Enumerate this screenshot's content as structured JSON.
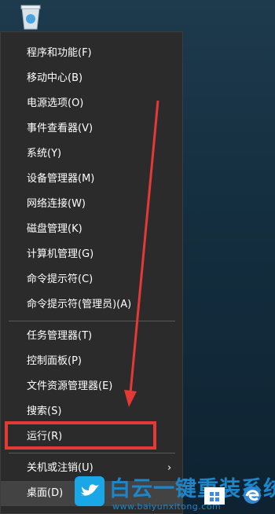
{
  "menu": {
    "items": [
      {
        "label": "程序和功能(F)"
      },
      {
        "label": "移动中心(B)"
      },
      {
        "label": "电源选项(O)"
      },
      {
        "label": "事件查看器(V)"
      },
      {
        "label": "系统(Y)"
      },
      {
        "label": "设备管理器(M)"
      },
      {
        "label": "网络连接(W)"
      },
      {
        "label": "磁盘管理(K)"
      },
      {
        "label": "计算机管理(G)"
      },
      {
        "label": "命令提示符(C)"
      },
      {
        "label": "命令提示符(管理员)(A)"
      },
      {
        "label": "任务管理器(T)"
      },
      {
        "label": "控制面板(P)"
      },
      {
        "label": "文件资源管理器(E)"
      },
      {
        "label": "搜索(S)"
      },
      {
        "label": "运行(R)"
      },
      {
        "label": "关机或注销(U)",
        "submenu_arrow": "›"
      },
      {
        "label": "桌面(D)"
      }
    ]
  },
  "watermark": {
    "title": "白云一键重装系统",
    "url": "www.baiyunxitong.com"
  },
  "colors": {
    "menu_bg": "#2b2b2b",
    "highlight": "#e53935",
    "watermark": "#1d86c9"
  }
}
